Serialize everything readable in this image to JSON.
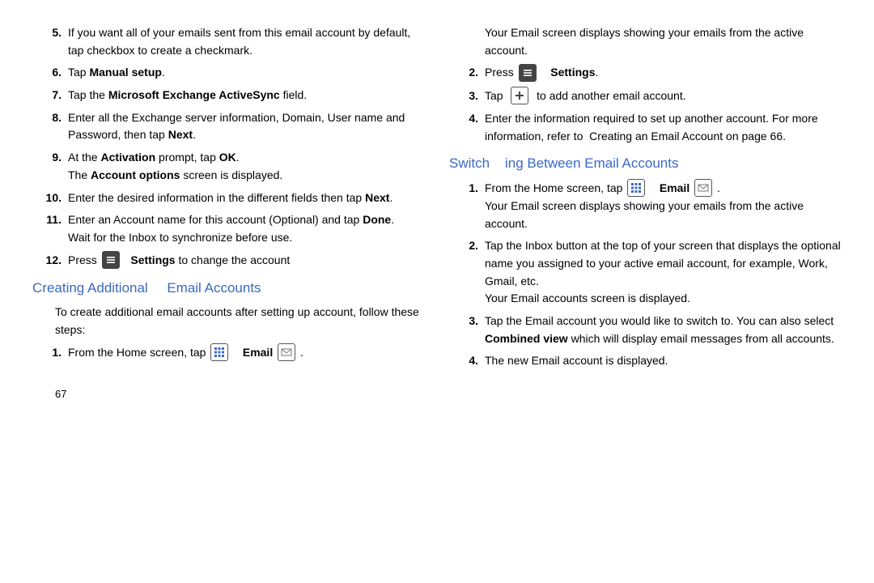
{
  "left": {
    "items": [
      {
        "n": "5.",
        "html": "If you want all of your emails sent from this email account by default, tap checkbox to create a checkmark."
      },
      {
        "n": "6.",
        "html": "Tap <span class='b'>Manual setup</span>."
      },
      {
        "n": "7.",
        "html": "Tap the <span class='b'>Microsoft Exchange ActiveSync</span> field."
      },
      {
        "n": "8.",
        "html": "Enter all the Exchange server information, Domain, User name and Password, then tap <span class='b'>Next</span>."
      },
      {
        "n": "9.",
        "html": "At the <span class='b'>Activation</span> prompt, tap <span class='b'>OK</span>.<br>The <span class='b'>Account options</span> screen is displayed."
      },
      {
        "n": "10.",
        "html": "Enter the desired information in the different fields then tap <span class='b'>Next</span>."
      },
      {
        "n": "11.",
        "html": "Enter an Account name for this account (Optional) and tap <span class='b'>Done</span>.<br>Wait for the Inbox to synchronize before use."
      },
      {
        "n": "12.",
        "html": "Press {MENU} &nbsp; <span class='b'>Settings</span> to change the account"
      }
    ],
    "heading": "Creating Additional &nbsp;&nbsp;&nbsp; Email Accounts",
    "intro": "To create additional email accounts after setting up account, follow these steps:",
    "sub": [
      {
        "n": "1.",
        "html": "From the Home screen, tap {GRID} &nbsp;&nbsp; <span class='b'>Email</span> {ENV} ."
      }
    ],
    "pagenum": "67"
  },
  "right": {
    "top": "Your Email screen displays showing your emails from the active account.",
    "items1": [
      {
        "n": "2.",
        "html": "Press {MENU} &nbsp;&nbsp; <span class='b'>Settings</span>."
      },
      {
        "n": "3.",
        "html": "Tap &nbsp;{PLUS}&nbsp; to add another email account."
      },
      {
        "n": "4.",
        "html": "Enter the information required to set up another account. For more information, refer to &nbsp;Creating an Email Account on page 66."
      }
    ],
    "heading": "Switch &nbsp;&nbsp; ing Between Email Accounts",
    "items2": [
      {
        "n": "1.",
        "html": "From the Home screen, tap {GRID} &nbsp;&nbsp; <span class='b'>Email</span> {ENV} .<br>Your Email screen displays showing your emails from the active account."
      },
      {
        "n": "2.",
        "html": "Tap the Inbox button at the top of your screen that displays the optional name you assigned to your active email account, for example, Work, Gmail, etc.<br>Your Email accounts screen is displayed."
      },
      {
        "n": "3.",
        "html": "Tap the Email account you would like to switch to. You can also select <span class='b'>Combined view</span> which will display email messages from all accounts."
      },
      {
        "n": "4.",
        "html": "The new Email account is displayed."
      }
    ]
  }
}
